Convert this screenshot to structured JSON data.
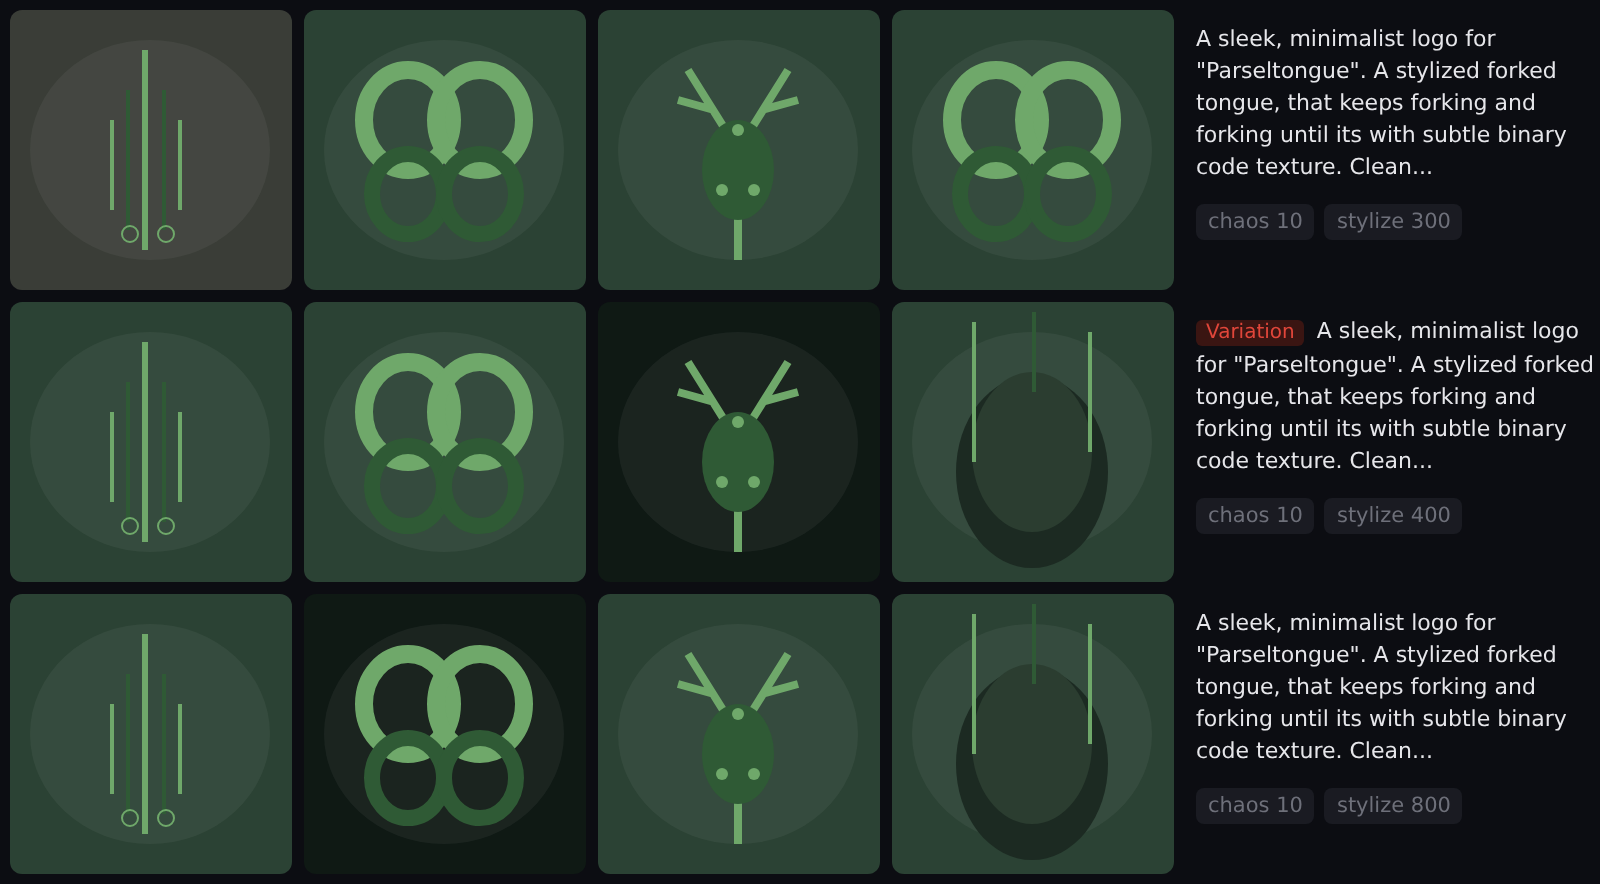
{
  "rows": [
    {
      "images": [
        {
          "kind": "picture"
        },
        {
          "kind": "picture"
        },
        {
          "kind": "picture"
        },
        {
          "kind": "picture"
        }
      ],
      "prompt": "A sleek, minimalist logo for \"Parseltongue\". A stylized forked tongue, that keeps forking and forking until its with subtle binary code texture. Clean...",
      "params": [
        "chaos 10",
        "stylize 300"
      ]
    },
    {
      "images": [
        {
          "kind": "picture"
        },
        {
          "kind": "picture"
        },
        {
          "kind": "picture"
        },
        {
          "kind": "picture"
        }
      ],
      "badge": "Variation",
      "prompt": "A sleek, minimalist logo for \"Parseltongue\". A stylized forked tongue, that keeps forking and forking until its with subtle binary code texture. Clean...",
      "params": [
        "chaos 10",
        "stylize 400"
      ]
    },
    {
      "images": [
        {
          "kind": "picture"
        },
        {
          "kind": "picture"
        },
        {
          "kind": "picture"
        },
        {
          "kind": "picture"
        }
      ],
      "prompt": "A sleek, minimalist logo for \"Parseltongue\". A stylized forked tongue, that keeps forking and forking until its with subtle binary code texture. Clean...",
      "params": [
        "chaos 10",
        "stylize 800"
      ]
    }
  ]
}
